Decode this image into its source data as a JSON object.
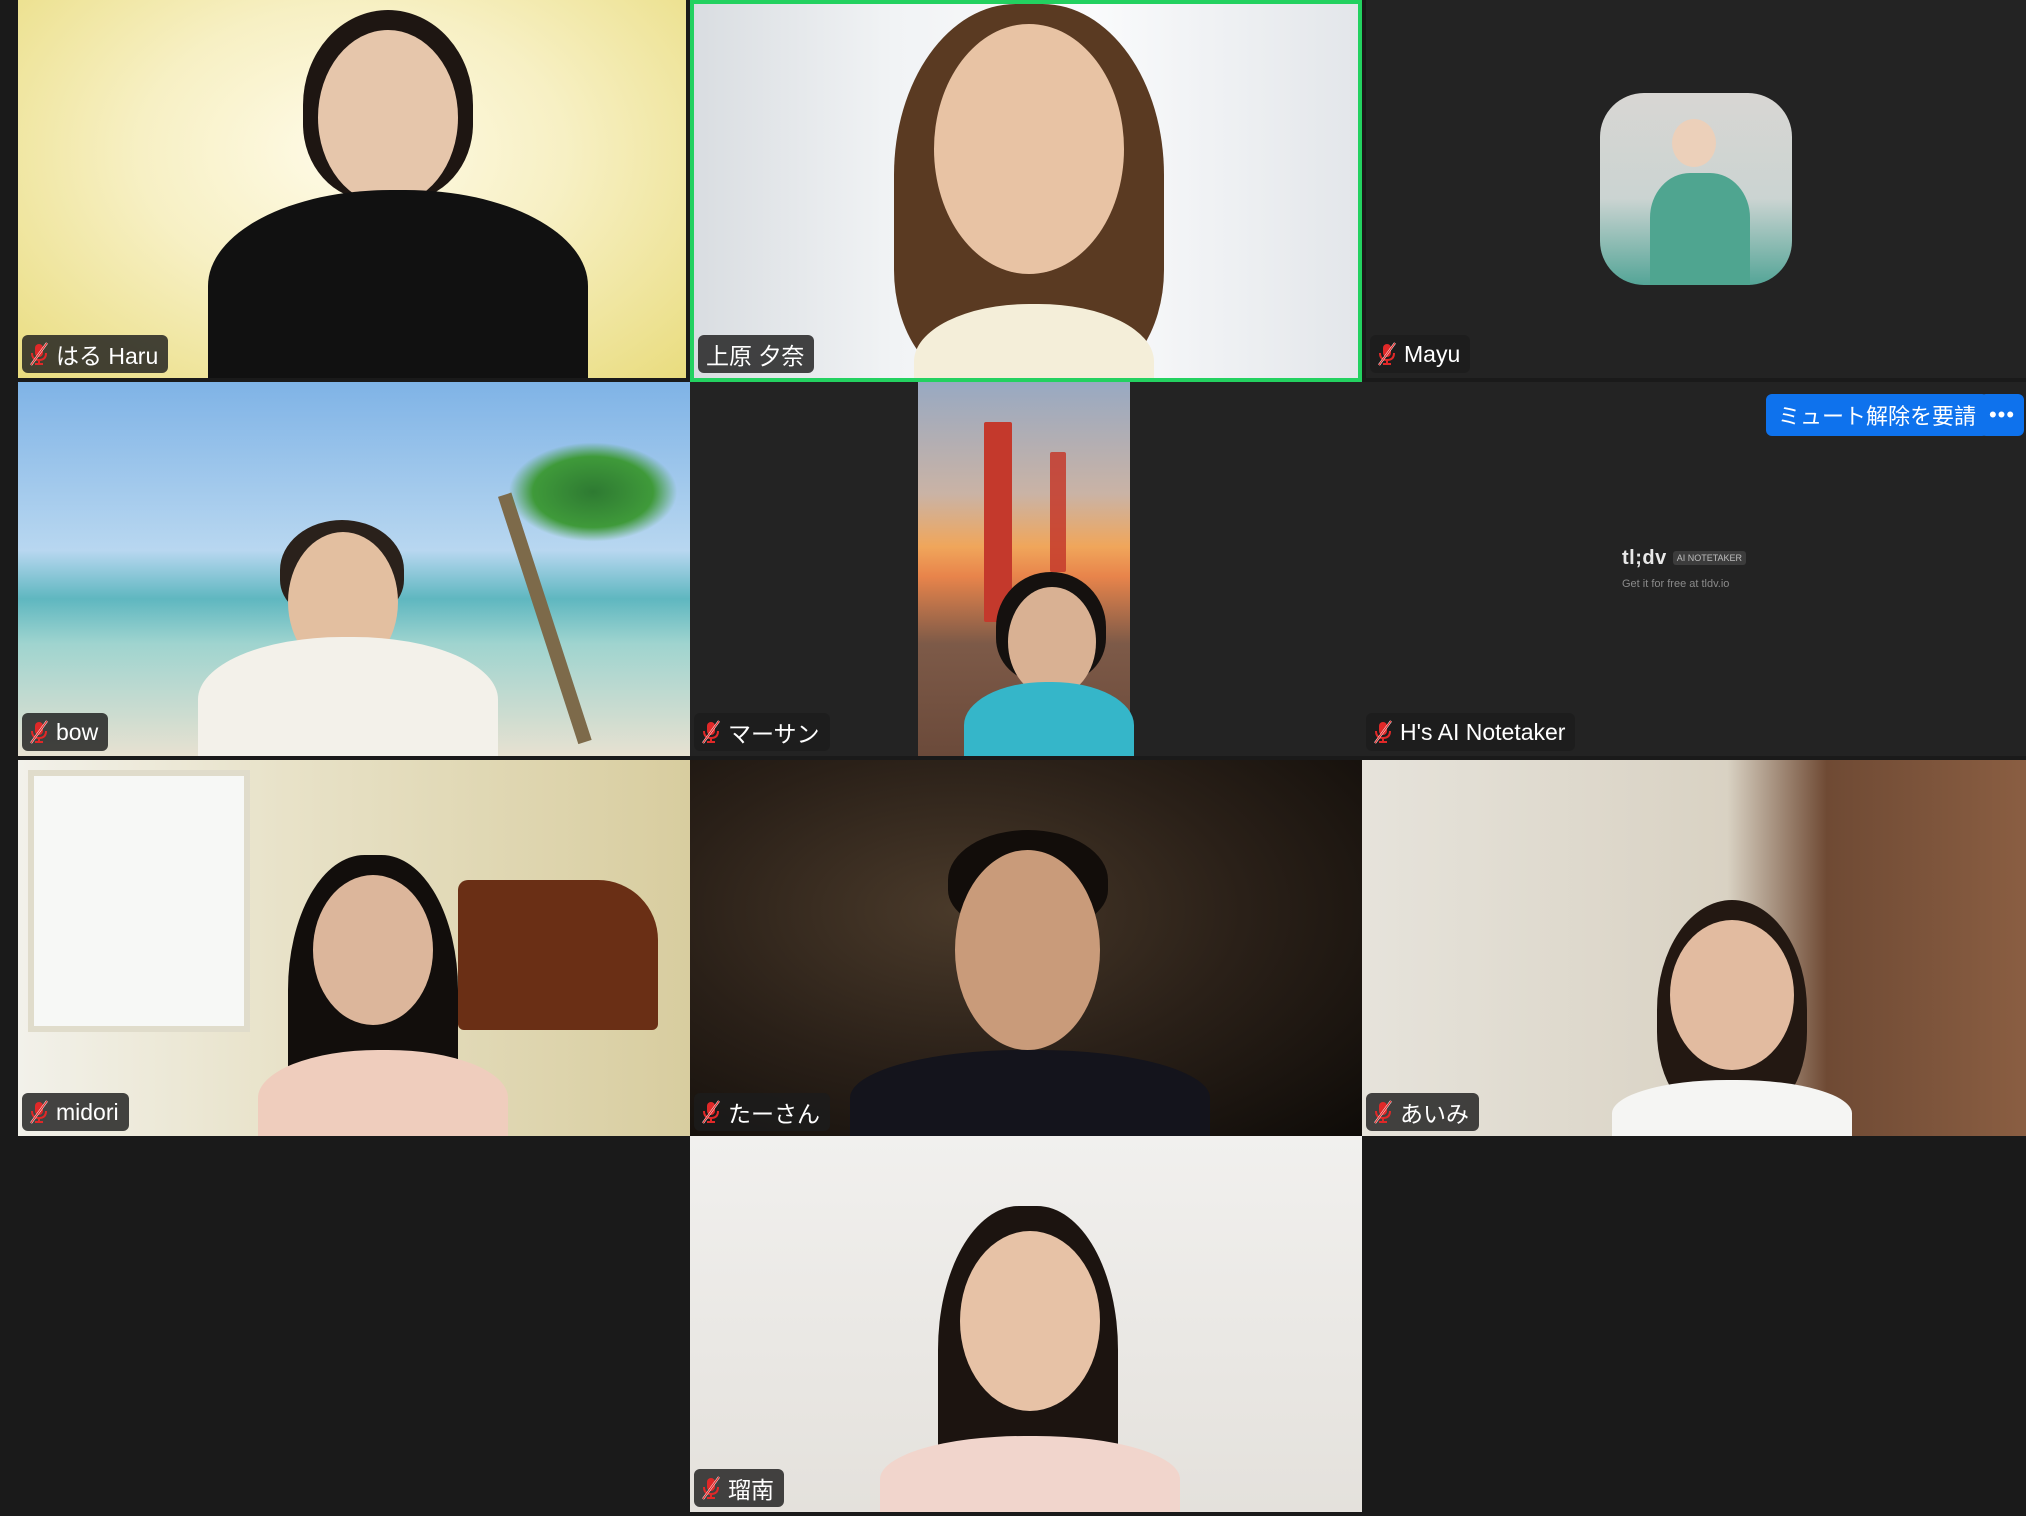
{
  "participants": [
    {
      "name": "はる Haru",
      "muted": true
    },
    {
      "name": "上原 夕奈",
      "muted": false,
      "active_speaker": true
    },
    {
      "name": "Mayu",
      "muted": true
    },
    {
      "name": "bow",
      "muted": true
    },
    {
      "name": "マーサン",
      "muted": true
    },
    {
      "name": "H's AI Notetaker",
      "muted": true
    },
    {
      "name": "midori",
      "muted": true
    },
    {
      "name": "たーさん",
      "muted": true
    },
    {
      "name": "あいみ",
      "muted": true
    },
    {
      "name": "瑠南",
      "muted": true
    }
  ],
  "notetaker": {
    "brand": "tl;dv",
    "tag": "AI NOTETAKER",
    "subtitle": "Get it for free at tldv.io",
    "request_unmute_label": "ミュート解除を要請",
    "more_label": "•••"
  },
  "colors": {
    "active_speaker_border": "#23d160",
    "muted_icon": "#e02828",
    "request_button": "#0e72ed",
    "background": "#1a1a1a"
  },
  "icons": {
    "mic_muted": "mic-muted-icon",
    "more": "ellipsis-icon"
  }
}
